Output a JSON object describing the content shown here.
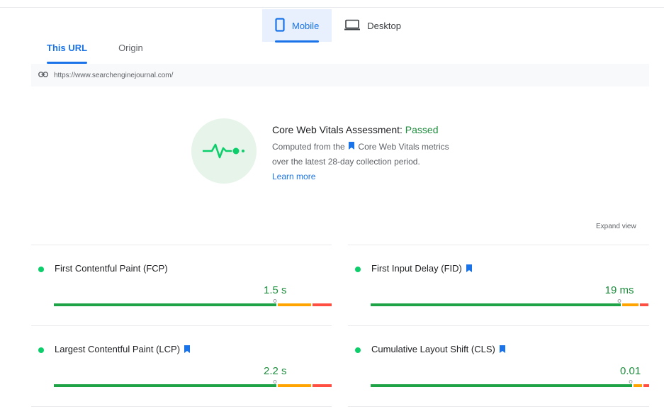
{
  "device_tabs": {
    "mobile": "Mobile",
    "desktop": "Desktop"
  },
  "url_tabs": {
    "this_url": "This URL",
    "origin": "Origin"
  },
  "url": "https://www.searchenginejournal.com/",
  "assessment": {
    "title": "Core Web Vitals Assessment:",
    "status": "Passed",
    "desc_line1_pre": "Computed from the",
    "desc_line1_post": "Core Web Vitals metrics",
    "desc_line2": "over the latest 28-day collection period.",
    "learn_more": "Learn more"
  },
  "expand_view": "Expand view",
  "colors": {
    "good": "#0cce6b",
    "good_bar": "#1ea446",
    "needs_improvement": "#ffa400",
    "poor": "#ff4e42",
    "accent": "#1a73e8"
  },
  "metrics": {
    "fcp": {
      "label": "First Contentful Paint (FCP)",
      "value": "1.5 s",
      "core_vital": false,
      "distribution": [
        0.81,
        0.12,
        0.07
      ]
    },
    "fid": {
      "label": "First Input Delay (FID)",
      "value": "19 ms",
      "core_vital": true,
      "distribution": [
        0.91,
        0.06,
        0.03
      ]
    },
    "lcp": {
      "label": "Largest Contentful Paint (LCP)",
      "value": "2.2 s",
      "core_vital": true,
      "distribution": [
        0.81,
        0.12,
        0.07
      ]
    },
    "cls": {
      "label": "Cumulative Layout Shift (CLS)",
      "value": "0.01",
      "core_vital": true,
      "distribution": [
        0.95,
        0.03,
        0.02
      ]
    }
  }
}
